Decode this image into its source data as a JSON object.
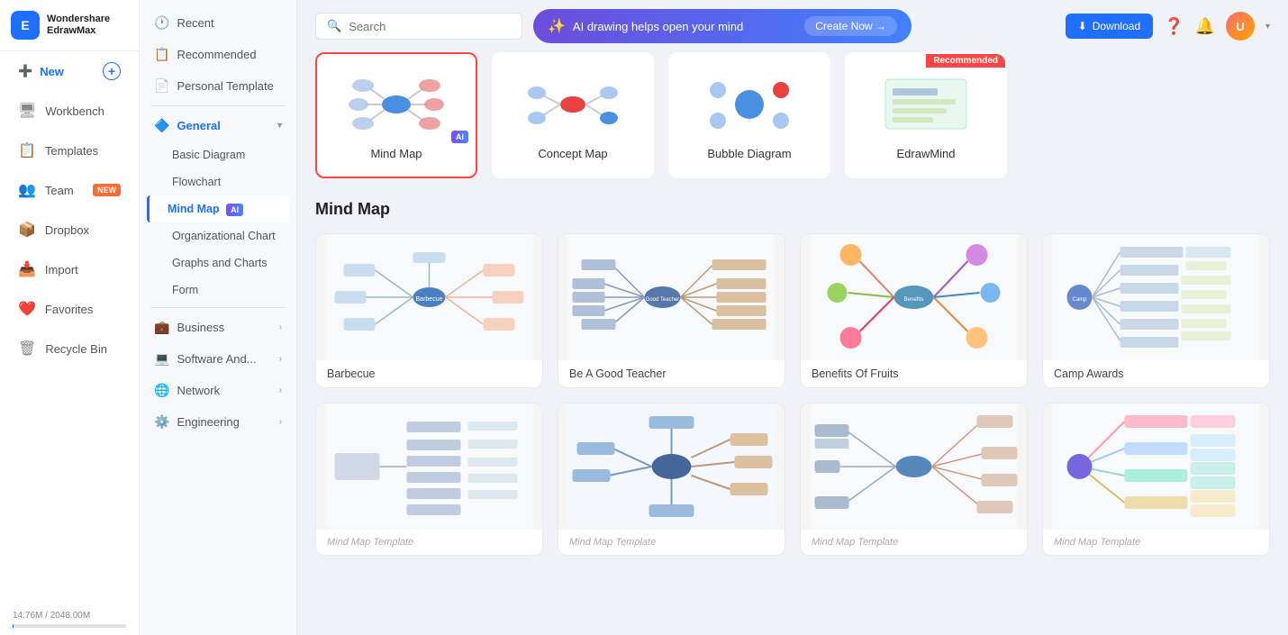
{
  "app": {
    "name": "Wondershare EdrawMax",
    "logo_text_line1": "Wondershare",
    "logo_text_line2": "EdrawMax"
  },
  "sidebar": {
    "items": [
      {
        "id": "new",
        "label": "New",
        "icon": "➕",
        "badge": null,
        "active": false
      },
      {
        "id": "workbench",
        "label": "Workbench",
        "icon": "🖥",
        "badge": null,
        "active": false
      },
      {
        "id": "templates",
        "label": "Templates",
        "icon": "📄",
        "badge": null,
        "active": false
      },
      {
        "id": "team",
        "label": "Team",
        "icon": "👥",
        "badge": "NEW",
        "active": false
      },
      {
        "id": "dropbox",
        "label": "Dropbox",
        "icon": "📦",
        "badge": null,
        "active": false
      },
      {
        "id": "import",
        "label": "Import",
        "icon": "📥",
        "badge": null,
        "active": false
      },
      {
        "id": "favorites",
        "label": "Favorites",
        "icon": "❤️",
        "badge": null,
        "active": false
      },
      {
        "id": "recycle-bin",
        "label": "Recycle Bin",
        "icon": "🗑",
        "badge": null,
        "active": false
      }
    ],
    "storage": {
      "used": "14.76M",
      "total": "2048.00M",
      "label": "14.76M / 2048.00M"
    }
  },
  "nav": {
    "top_items": [
      {
        "id": "recent",
        "label": "Recent",
        "icon": "🕐"
      },
      {
        "id": "recommended",
        "label": "Recommended",
        "icon": "📋"
      },
      {
        "id": "personal-template",
        "label": "Personal Template",
        "icon": "📄"
      }
    ],
    "sections": [
      {
        "id": "general",
        "label": "General",
        "expanded": true,
        "sub_items": [
          {
            "id": "basic-diagram",
            "label": "Basic Diagram",
            "active": false
          },
          {
            "id": "flowchart",
            "label": "Flowchart",
            "active": false
          },
          {
            "id": "mind-map",
            "label": "Mind Map",
            "active": true,
            "ai": true
          },
          {
            "id": "org-chart",
            "label": "Organizational Chart",
            "active": false
          },
          {
            "id": "graphs-charts",
            "label": "Graphs and Charts",
            "active": false
          },
          {
            "id": "form",
            "label": "Form",
            "active": false
          }
        ]
      },
      {
        "id": "business",
        "label": "Business",
        "expanded": false
      },
      {
        "id": "software",
        "label": "Software And...",
        "expanded": false
      },
      {
        "id": "network",
        "label": "Network",
        "expanded": false
      },
      {
        "id": "engineering",
        "label": "Engineering",
        "expanded": false
      }
    ]
  },
  "topbar": {
    "search_placeholder": "Search",
    "ai_banner": {
      "text": "AI drawing helps open your mind",
      "create_label": "Create Now →"
    },
    "download_label": "Download"
  },
  "category_cards": [
    {
      "id": "mind-map",
      "label": "Mind Map",
      "selected": true,
      "ai": true,
      "recommended": false
    },
    {
      "id": "concept-map",
      "label": "Concept Map",
      "selected": false,
      "ai": false,
      "recommended": false
    },
    {
      "id": "bubble-diagram",
      "label": "Bubble Diagram",
      "selected": false,
      "ai": false,
      "recommended": false
    },
    {
      "id": "edrawmind",
      "label": "EdrawMind",
      "selected": false,
      "ai": false,
      "recommended": true
    }
  ],
  "mind_map_section": {
    "title": "Mind Map",
    "templates": [
      {
        "id": "barbecue",
        "label": "Barbecue"
      },
      {
        "id": "good-teacher",
        "label": "Be A Good Teacher"
      },
      {
        "id": "benefits-fruits",
        "label": "Benefits Of Fruits"
      },
      {
        "id": "camp-awards",
        "label": "Camp Awards"
      },
      {
        "id": "template5",
        "label": ""
      },
      {
        "id": "template6",
        "label": ""
      },
      {
        "id": "template7",
        "label": ""
      },
      {
        "id": "template8",
        "label": ""
      }
    ]
  }
}
